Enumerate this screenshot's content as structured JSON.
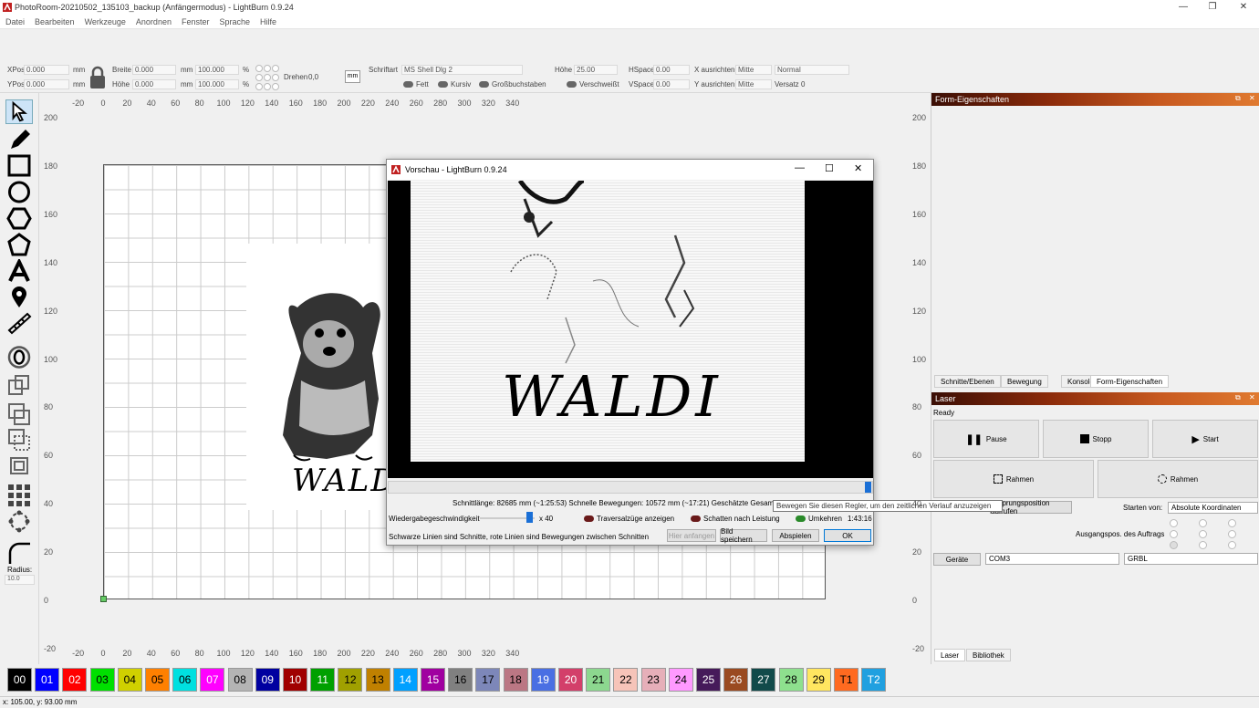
{
  "window": {
    "title": "PhotoRoom-20210502_135103_backup (Anfängermodus) - LightBurn 0.9.24",
    "min": "—",
    "max": "❐",
    "close": "✕"
  },
  "menu": [
    "Datei",
    "Bearbeiten",
    "Werkzeuge",
    "Anordnen",
    "Fenster",
    "Sprache",
    "Hilfe"
  ],
  "props": {
    "xpos_label": "XPos",
    "xpos": "0.000",
    "ypos_label": "YPos",
    "ypos": "0.000",
    "unit": "mm",
    "breite_label": "Breite",
    "breite": "0.000",
    "hoehe_label": "Höhe",
    "hoehe": "0.000",
    "pct1": "100.000",
    "pct2": "100.000",
    "pct": "%",
    "drehen_label": "Drehen",
    "drehen": "0,0",
    "mm_btn": "mm",
    "schriftart_label": "Schriftart",
    "schriftart": "MS Shell Dlg 2",
    "hoehe2_label": "Höhe",
    "hoehe2": "25.00",
    "hspace_label": "HSpace",
    "hspace": "0.00",
    "vspace_label": "VSpace",
    "vspace": "0.00",
    "xausr_label": "X ausrichten",
    "xausr": "Mitte",
    "yausr_label": "Y ausrichten",
    "yausr": "Mitte",
    "normal": "Normal",
    "versatz_label": "Versatz",
    "versatz": "0",
    "fett": "Fett",
    "kursiv": "Kursiv",
    "gross": "Großbuchstaben",
    "verschw": "Verschweißt"
  },
  "ruler": {
    "top": [
      "-20",
      "0",
      "20",
      "40",
      "60",
      "80",
      "100",
      "120",
      "140",
      "160",
      "180",
      "200",
      "220",
      "240",
      "260",
      "280",
      "300",
      "320",
      "340"
    ],
    "left": [
      "200",
      "180",
      "160",
      "140",
      "120",
      "100",
      "80",
      "60",
      "40",
      "20",
      "0",
      "-20"
    ]
  },
  "tools": {
    "radius_label": "Radius:",
    "radius": "10.0"
  },
  "canvas": {
    "text": "WALDI"
  },
  "dialog": {
    "title": "Vorschau - LightBurn 0.9.24",
    "text": "WALDI",
    "stats": "Schnittlänge: 82685 mm (~1:25:53) Schnelle Bewegungen: 10572 mm (~17:21) Geschätzte Gesamtzeit: 1:43:16",
    "speed_label": "Wiedergabegeschwindigkeit",
    "speed": "x 40",
    "trav": "Traversalzüge anzeigen",
    "shadow": "Schatten nach Leistung",
    "invert": "Umkehren",
    "time": "1:43:16",
    "note": "Schwarze Linien sind Schnitte, rote Linien sind Bewegungen zwischen Schnitten",
    "btn_here": "Hier anfangen",
    "btn_save": "Bild speichern",
    "btn_play": "Abspielen",
    "btn_ok": "OK"
  },
  "tooltip": "Bewegen Sie diesen Regler, um den zeitlichen Verlauf anzuzeigen",
  "right": {
    "form_title": "Form-Eigenschaften",
    "tabs": [
      "Schnitte/Ebenen",
      "Bewegung",
      "Konsole",
      "Form-Eigenschaften"
    ],
    "laser_title": "Laser",
    "status": "Ready",
    "pause": "Pause",
    "stopp": "Stopp",
    "start": "Start",
    "rahmen1": "Rahmen",
    "rahmen2": "Rahmen",
    "home_btn": "Ursprungsposition aufrufen",
    "start_from_label": "Starten von:",
    "start_from": "Absolute Koordinaten",
    "jobpos_label": "Ausgangspos. des Auftrags",
    "devices": "Geräte",
    "port": "COM3",
    "ctrl": "GRBL",
    "bottom_tabs": [
      "Laser",
      "Bibliothek"
    ]
  },
  "palette": [
    {
      "l": "00",
      "c": "#000000",
      "t": "#ffffff"
    },
    {
      "l": "01",
      "c": "#0000ff",
      "t": "#ffffff"
    },
    {
      "l": "02",
      "c": "#ff0000",
      "t": "#ffffff"
    },
    {
      "l": "03",
      "c": "#00e000",
      "t": "#000000"
    },
    {
      "l": "04",
      "c": "#d0d000",
      "t": "#000000"
    },
    {
      "l": "05",
      "c": "#ff8000",
      "t": "#000000"
    },
    {
      "l": "06",
      "c": "#00e0e0",
      "t": "#000000"
    },
    {
      "l": "07",
      "c": "#ff00ff",
      "t": "#ffffff"
    },
    {
      "l": "08",
      "c": "#b4b4b4",
      "t": "#000000"
    },
    {
      "l": "09",
      "c": "#0000a0",
      "t": "#ffffff"
    },
    {
      "l": "10",
      "c": "#a00000",
      "t": "#ffffff"
    },
    {
      "l": "11",
      "c": "#00a000",
      "t": "#ffffff"
    },
    {
      "l": "12",
      "c": "#a0a000",
      "t": "#000000"
    },
    {
      "l": "13",
      "c": "#c08000",
      "t": "#000000"
    },
    {
      "l": "14",
      "c": "#00a0ff",
      "t": "#ffffff"
    },
    {
      "l": "15",
      "c": "#a000a0",
      "t": "#ffffff"
    },
    {
      "l": "16",
      "c": "#808080",
      "t": "#000000"
    },
    {
      "l": "17",
      "c": "#7d87b9",
      "t": "#000000"
    },
    {
      "l": "18",
      "c": "#bb7784",
      "t": "#000000"
    },
    {
      "l": "19",
      "c": "#4a6fe3",
      "t": "#ffffff"
    },
    {
      "l": "20",
      "c": "#d33f6a",
      "t": "#ffffff"
    },
    {
      "l": "21",
      "c": "#8cd78f",
      "t": "#000000"
    },
    {
      "l": "22",
      "c": "#f6c4b9",
      "t": "#000000"
    },
    {
      "l": "23",
      "c": "#e6afb9",
      "t": "#000000"
    },
    {
      "l": "24",
      "c": "#ff99ff",
      "t": "#000000"
    },
    {
      "l": "25",
      "c": "#461a5a",
      "t": "#ffffff"
    },
    {
      "l": "26",
      "c": "#9a4a20",
      "t": "#ffffff"
    },
    {
      "l": "27",
      "c": "#114a4a",
      "t": "#ffffff"
    },
    {
      "l": "28",
      "c": "#8ee08e",
      "t": "#000000"
    },
    {
      "l": "29",
      "c": "#ffe660",
      "t": "#000000"
    },
    {
      "l": "T1",
      "c": "#ff6a20",
      "t": "#000000"
    },
    {
      "l": "T2",
      "c": "#20a0e0",
      "t": "#ffffff"
    }
  ],
  "status": "x: 105.00, y: 93.00 mm"
}
